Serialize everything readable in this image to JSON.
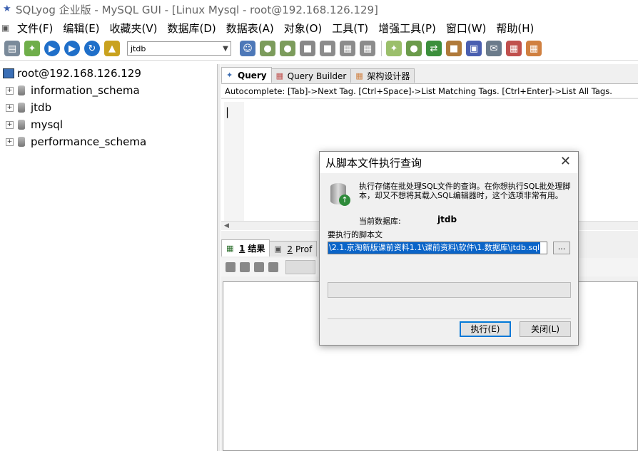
{
  "window": {
    "title": "SQLyog 企业版 - MySQL GUI - [Linux Mysql - root@192.168.126.129]"
  },
  "menu": [
    "文件(F)",
    "编辑(E)",
    "收藏夹(V)",
    "数据库(D)",
    "数据表(A)",
    "对象(O)",
    "工具(T)",
    "增强工具(P)",
    "窗口(W)",
    "帮助(H)"
  ],
  "toolbar": {
    "db_selector": "jtdb"
  },
  "tree": {
    "root": "root@192.168.126.129",
    "items": [
      "information_schema",
      "jtdb",
      "mysql",
      "performance_schema"
    ]
  },
  "query_tabs": [
    "Query",
    "Query Builder",
    "架构设计器"
  ],
  "autocomplete_hint": "Autocomplete: [Tab]->Next Tag. [Ctrl+Space]->List Matching Tags. [Ctrl+Enter]->List All Tags.",
  "result_tabs": [
    {
      "num": "1",
      "label": "结果"
    },
    {
      "num": "2",
      "label": "Prof"
    }
  ],
  "dialog": {
    "title": "从脚本文件执行查询",
    "description": "执行存储在批处理SQL文件的查询。在你想执行SQL批处理脚本，却又不想将其载入SQL编辑器时，这个选项非常有用。",
    "current_db_label": "当前数据库:",
    "current_db_value": "jtdb",
    "file_label": "要执行的脚本文",
    "file_path": "\\2.1.京淘新版课前资料1.1\\课前资料\\软件\\1.数据库\\jtdb.sql",
    "browse_label": "...",
    "progress": 0,
    "execute_label": "执行(E)",
    "close_label": "关闭(L)"
  },
  "colors": {
    "accent": "#0a64c8",
    "progress_fill": "#06b025"
  }
}
